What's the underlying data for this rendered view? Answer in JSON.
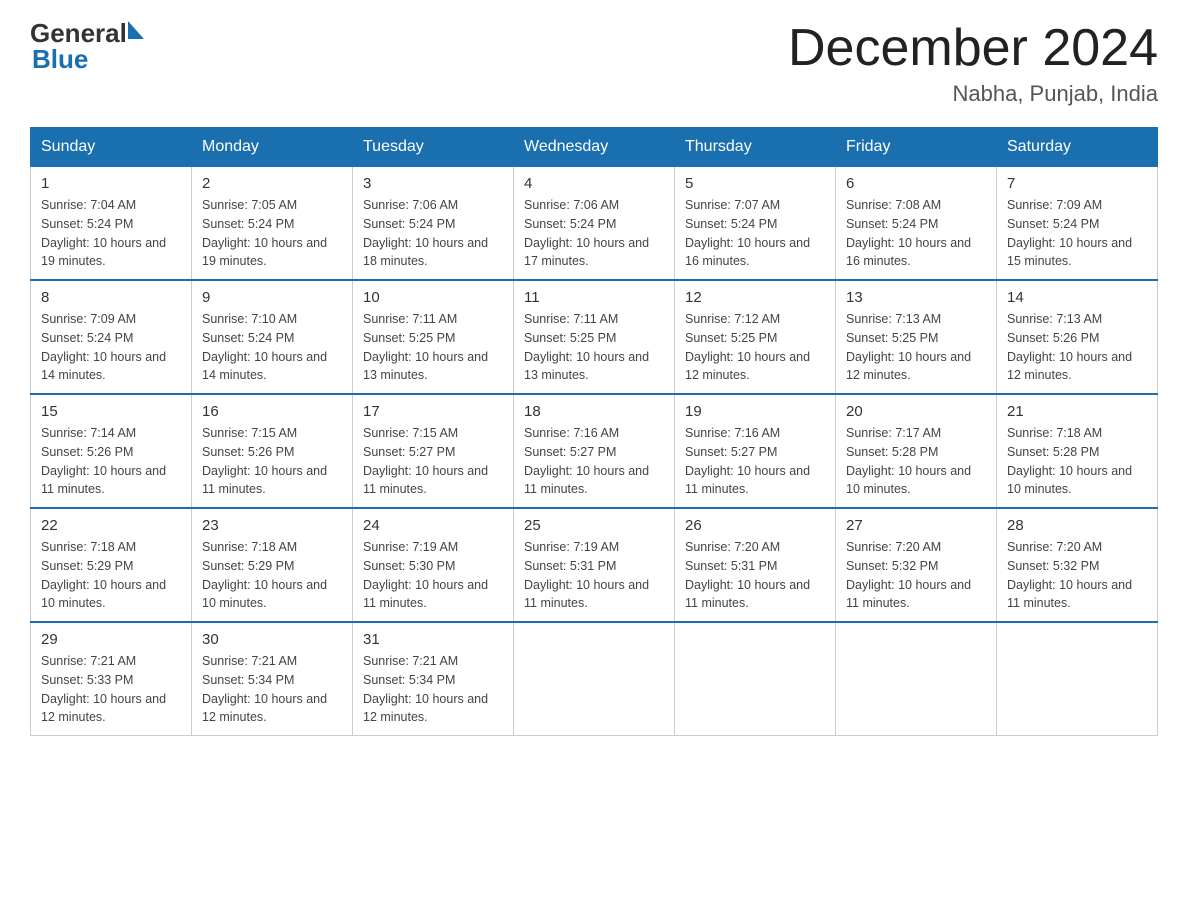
{
  "header": {
    "title": "December 2024",
    "subtitle": "Nabha, Punjab, India",
    "logo_general": "General",
    "logo_blue": "Blue"
  },
  "days_of_week": [
    "Sunday",
    "Monday",
    "Tuesday",
    "Wednesday",
    "Thursday",
    "Friday",
    "Saturday"
  ],
  "weeks": [
    [
      {
        "day": "1",
        "sunrise": "7:04 AM",
        "sunset": "5:24 PM",
        "daylight": "10 hours and 19 minutes."
      },
      {
        "day": "2",
        "sunrise": "7:05 AM",
        "sunset": "5:24 PM",
        "daylight": "10 hours and 19 minutes."
      },
      {
        "day": "3",
        "sunrise": "7:06 AM",
        "sunset": "5:24 PM",
        "daylight": "10 hours and 18 minutes."
      },
      {
        "day": "4",
        "sunrise": "7:06 AM",
        "sunset": "5:24 PM",
        "daylight": "10 hours and 17 minutes."
      },
      {
        "day": "5",
        "sunrise": "7:07 AM",
        "sunset": "5:24 PM",
        "daylight": "10 hours and 16 minutes."
      },
      {
        "day": "6",
        "sunrise": "7:08 AM",
        "sunset": "5:24 PM",
        "daylight": "10 hours and 16 minutes."
      },
      {
        "day": "7",
        "sunrise": "7:09 AM",
        "sunset": "5:24 PM",
        "daylight": "10 hours and 15 minutes."
      }
    ],
    [
      {
        "day": "8",
        "sunrise": "7:09 AM",
        "sunset": "5:24 PM",
        "daylight": "10 hours and 14 minutes."
      },
      {
        "day": "9",
        "sunrise": "7:10 AM",
        "sunset": "5:24 PM",
        "daylight": "10 hours and 14 minutes."
      },
      {
        "day": "10",
        "sunrise": "7:11 AM",
        "sunset": "5:25 PM",
        "daylight": "10 hours and 13 minutes."
      },
      {
        "day": "11",
        "sunrise": "7:11 AM",
        "sunset": "5:25 PM",
        "daylight": "10 hours and 13 minutes."
      },
      {
        "day": "12",
        "sunrise": "7:12 AM",
        "sunset": "5:25 PM",
        "daylight": "10 hours and 12 minutes."
      },
      {
        "day": "13",
        "sunrise": "7:13 AM",
        "sunset": "5:25 PM",
        "daylight": "10 hours and 12 minutes."
      },
      {
        "day": "14",
        "sunrise": "7:13 AM",
        "sunset": "5:26 PM",
        "daylight": "10 hours and 12 minutes."
      }
    ],
    [
      {
        "day": "15",
        "sunrise": "7:14 AM",
        "sunset": "5:26 PM",
        "daylight": "10 hours and 11 minutes."
      },
      {
        "day": "16",
        "sunrise": "7:15 AM",
        "sunset": "5:26 PM",
        "daylight": "10 hours and 11 minutes."
      },
      {
        "day": "17",
        "sunrise": "7:15 AM",
        "sunset": "5:27 PM",
        "daylight": "10 hours and 11 minutes."
      },
      {
        "day": "18",
        "sunrise": "7:16 AM",
        "sunset": "5:27 PM",
        "daylight": "10 hours and 11 minutes."
      },
      {
        "day": "19",
        "sunrise": "7:16 AM",
        "sunset": "5:27 PM",
        "daylight": "10 hours and 11 minutes."
      },
      {
        "day": "20",
        "sunrise": "7:17 AM",
        "sunset": "5:28 PM",
        "daylight": "10 hours and 10 minutes."
      },
      {
        "day": "21",
        "sunrise": "7:18 AM",
        "sunset": "5:28 PM",
        "daylight": "10 hours and 10 minutes."
      }
    ],
    [
      {
        "day": "22",
        "sunrise": "7:18 AM",
        "sunset": "5:29 PM",
        "daylight": "10 hours and 10 minutes."
      },
      {
        "day": "23",
        "sunrise": "7:18 AM",
        "sunset": "5:29 PM",
        "daylight": "10 hours and 10 minutes."
      },
      {
        "day": "24",
        "sunrise": "7:19 AM",
        "sunset": "5:30 PM",
        "daylight": "10 hours and 11 minutes."
      },
      {
        "day": "25",
        "sunrise": "7:19 AM",
        "sunset": "5:31 PM",
        "daylight": "10 hours and 11 minutes."
      },
      {
        "day": "26",
        "sunrise": "7:20 AM",
        "sunset": "5:31 PM",
        "daylight": "10 hours and 11 minutes."
      },
      {
        "day": "27",
        "sunrise": "7:20 AM",
        "sunset": "5:32 PM",
        "daylight": "10 hours and 11 minutes."
      },
      {
        "day": "28",
        "sunrise": "7:20 AM",
        "sunset": "5:32 PM",
        "daylight": "10 hours and 11 minutes."
      }
    ],
    [
      {
        "day": "29",
        "sunrise": "7:21 AM",
        "sunset": "5:33 PM",
        "daylight": "10 hours and 12 minutes."
      },
      {
        "day": "30",
        "sunrise": "7:21 AM",
        "sunset": "5:34 PM",
        "daylight": "10 hours and 12 minutes."
      },
      {
        "day": "31",
        "sunrise": "7:21 AM",
        "sunset": "5:34 PM",
        "daylight": "10 hours and 12 minutes."
      },
      null,
      null,
      null,
      null
    ]
  ],
  "sunrise_label": "Sunrise:",
  "sunset_label": "Sunset:",
  "daylight_label": "Daylight:"
}
